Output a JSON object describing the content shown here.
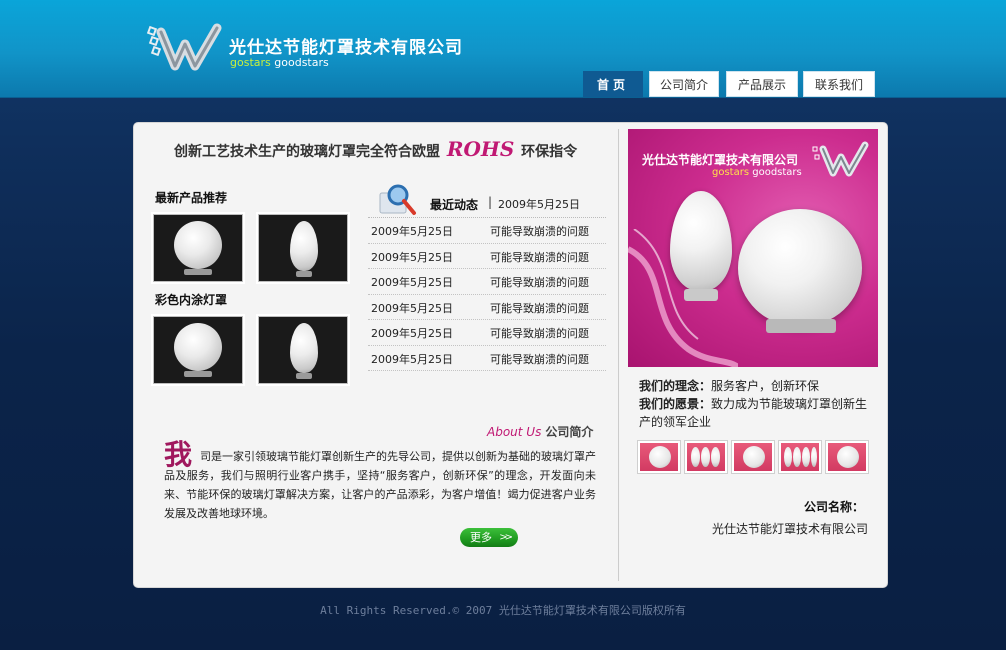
{
  "header": {
    "site_title": "光仕达节能灯罩技术有限公司",
    "brand_a": "gostars",
    "brand_b": "goodstars"
  },
  "nav": {
    "items": [
      {
        "label": "首页",
        "active": true
      },
      {
        "label": "公司简介",
        "active": false
      },
      {
        "label": "产品展示",
        "active": false
      },
      {
        "label": "联系我们",
        "active": false
      }
    ]
  },
  "slogan": {
    "before": "创新工艺技术生产的玻璃灯罩完全符合欧盟",
    "highlight": "ROHS",
    "after": "环保指令"
  },
  "products": {
    "new_title": "最新产品推荐",
    "color_title": "彩色内涂灯罩"
  },
  "news": {
    "label": "最近动态",
    "separator": "|",
    "head_date": "2009年5月25日",
    "rows": [
      {
        "date": "2009年5月25日",
        "title": "可能导致崩溃的问题"
      },
      {
        "date": "2009年5月25日",
        "title": "可能导致崩溃的问题"
      },
      {
        "date": "2009年5月25日",
        "title": "可能导致崩溃的问题"
      },
      {
        "date": "2009年5月25日",
        "title": "可能导致崩溃的问题"
      },
      {
        "date": "2009年5月25日",
        "title": "可能导致崩溃的问题"
      },
      {
        "date": "2009年5月25日",
        "title": "可能导致崩溃的问题"
      }
    ]
  },
  "about": {
    "title_en": "About Us",
    "title_cn": "公司简介",
    "first_char": "我",
    "text": "司是一家引领玻璃节能灯罩创新生产的先导公司，提供以创新为基础的玻璃灯罩产品及服务，我们与照明行业客户携手，坚持“服务客户，创新环保”的理念，开发面向未来、节能环保的玻璃灯罩解决方案，让客户的产品添彩，为客户增值！竭力促进客户业务发展及改善地球环境。",
    "more_label": "更多"
  },
  "banner": {
    "title": "光仕达节能灯罩技术有限公司",
    "brand_a": "gostars",
    "brand_b": "goodstars"
  },
  "philosophy": {
    "idea_label": "我们的理念：",
    "idea_text": "服务客户，创新环保",
    "vision_label": "我们的愿景：",
    "vision_text": "致力成为节能玻璃灯罩创新生产的领军企业"
  },
  "company": {
    "label": "公司名称：",
    "name": "光仕达节能灯罩技术有限公司"
  },
  "footer": {
    "text": "All Rights Reserved.© 2007 光仕达节能灯罩技术有限公司版权所有"
  },
  "colors": {
    "header_blue": "#0aa5d9",
    "nav_active": "#0f5a92",
    "accent_magenta": "#c01873",
    "more_green": "#1f9b20"
  }
}
